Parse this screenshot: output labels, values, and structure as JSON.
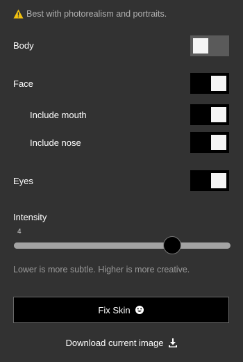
{
  "notice": {
    "text": "Best with photorealism and portraits.",
    "icon": "warning-icon"
  },
  "options": [
    {
      "label": "Body",
      "enabled": false
    },
    {
      "label": "Face",
      "enabled": true
    },
    {
      "label": "Include mouth",
      "enabled": true
    },
    {
      "label": "Include nose",
      "enabled": true
    },
    {
      "label": "Eyes",
      "enabled": true
    }
  ],
  "intensity": {
    "label": "Intensity",
    "value": "4",
    "fraction": 0.73,
    "hint": "Lower is more subtle. Higher is more creative."
  },
  "actions": {
    "fix_label": "Fix Skin",
    "fix_icon": "smile-icon",
    "download_label": "Download current image",
    "download_icon": "download-icon"
  },
  "colors": {
    "background": "#323232",
    "toggle_on": "#000000",
    "toggle_off": "#5a5a5a",
    "warning": "#f2c10f"
  }
}
